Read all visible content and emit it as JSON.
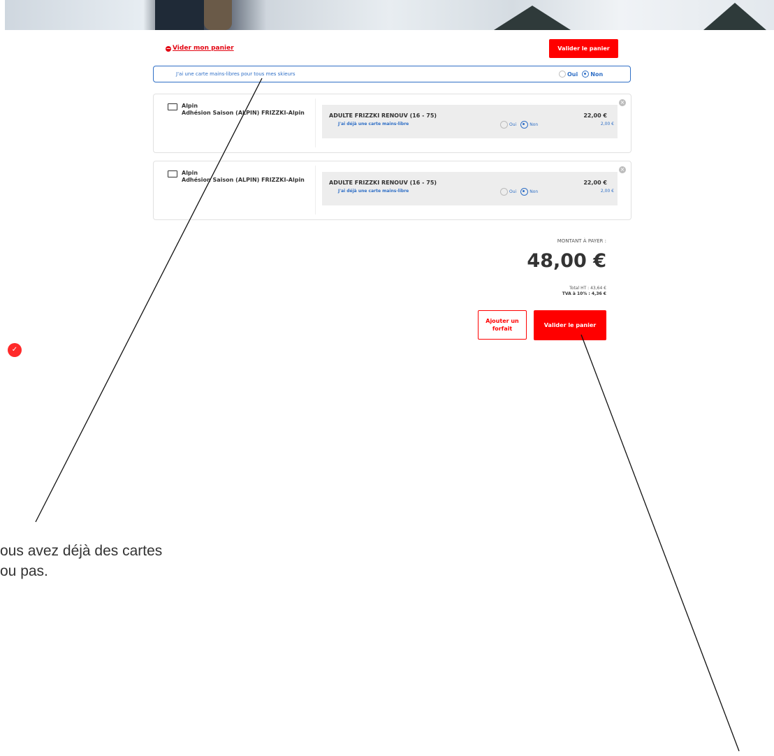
{
  "cart": {
    "clear_label": "Vider mon panier",
    "validate_top_label": "Valider le panier",
    "global_question": "J'ai une carte mains-libres pour tous mes skieurs",
    "global_option_yes": "Oui",
    "global_option_no": "Non",
    "global_selected": "Non",
    "items": [
      {
        "category": "Alpin",
        "product": "Adhésion Saison (ALPIN) FRIZZKI-Alpin",
        "pass_name": "ADULTE FRIZZKI RENOUV (16 - 75)",
        "price": "22,00 €",
        "card_question": "J'ai déjà une carte mains-libre",
        "option_yes": "Oui",
        "option_no": "Non",
        "selected": "Non",
        "option_price": "2,00 €"
      },
      {
        "category": "Alpin",
        "product": "Adhésion Saison (ALPIN) FRIZZKI-Alpin",
        "pass_name": "ADULTE FRIZZKI RENOUV (16 - 75)",
        "price": "22,00 €",
        "card_question": "J'ai déjà une carte mains-libre",
        "option_yes": "Oui",
        "option_no": "Non",
        "selected": "Non",
        "option_price": "2,00 €"
      }
    ],
    "total": {
      "label": "MONTANT À PAYER :",
      "amount": "48,00 €",
      "ht": "Total HT : 43,64 €",
      "tva": "TVA à 10% : 4,36 €"
    },
    "add_pass_label": "Ajouter un forfait",
    "validate_bottom_label": "Valider le panier"
  },
  "annotation": {
    "line1": "ous avez déjà des cartes",
    "line2": "ou pas."
  },
  "colors": {
    "accent": "#ff0000",
    "link_blue": "#2f6fc6"
  },
  "icons": {
    "clear": "minus-circle-icon",
    "folder": "folder-icon",
    "remove": "close-circle-icon",
    "badge": "checkmark-badge-icon"
  }
}
